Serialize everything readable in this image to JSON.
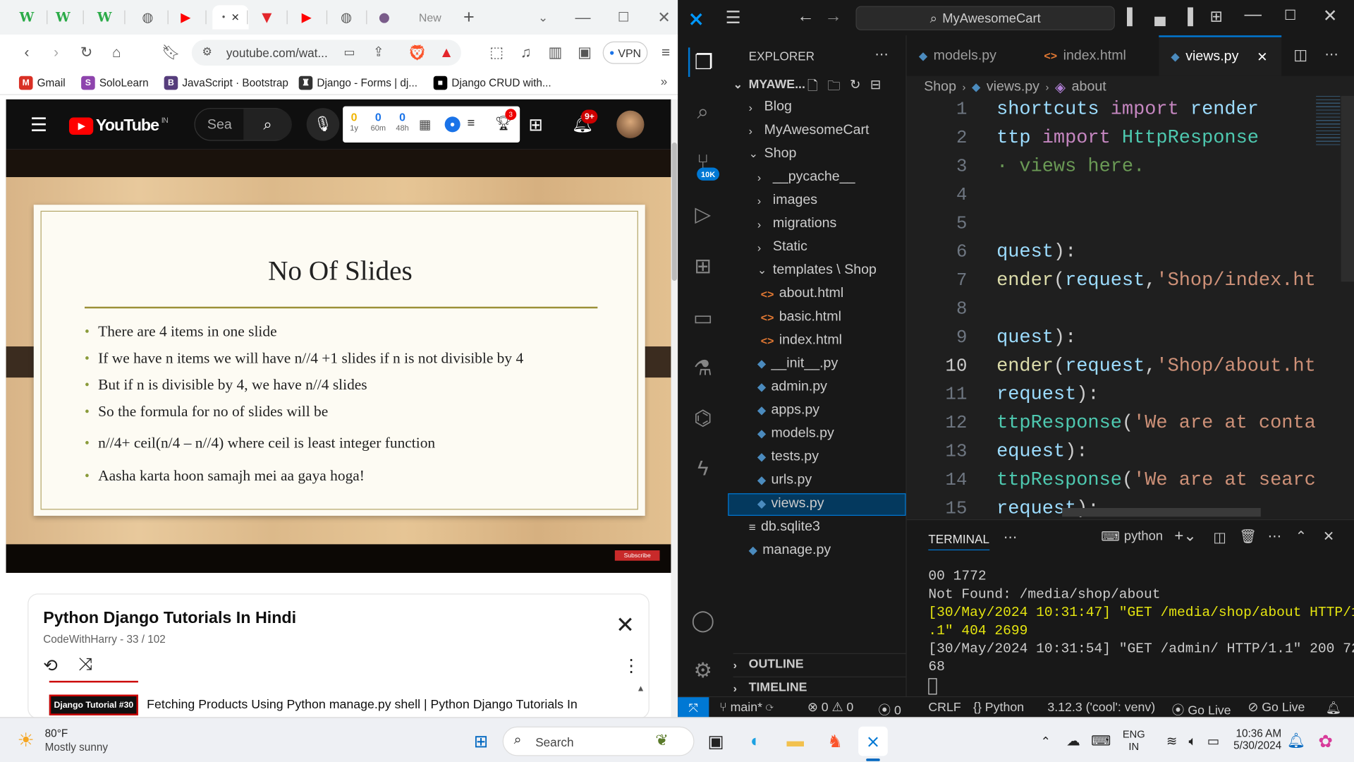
{
  "browser": {
    "tabs": [
      {
        "glyph": "W",
        "color": "#2bab48"
      },
      {
        "glyph": "W",
        "color": "#2bab48"
      },
      {
        "glyph": "W",
        "color": "#2bab48"
      },
      {
        "glyph": "◍",
        "color": "#555"
      },
      {
        "glyph": "▶",
        "color": "#ff0000"
      },
      {
        "glyph": "·",
        "color": "#555"
      },
      {
        "glyph": "▼",
        "color": "#e3262b"
      },
      {
        "glyph": "▶",
        "color": "#ff0000"
      },
      {
        "glyph": "◍",
        "color": "#555"
      },
      {
        "glyph": "●",
        "color": "#7a5c8a"
      }
    ],
    "new_tab_label": "New",
    "url": "youtube.com/wat...",
    "vpn_label": "VPN",
    "bookmarks": [
      {
        "label": "Gmail",
        "icon": "M",
        "color": "#d93025"
      },
      {
        "label": "SoloLearn",
        "icon": "S",
        "color": "#8e44ad"
      },
      {
        "label": "JavaScript · Bootstrap",
        "icon": "B",
        "color": "#563d7c"
      },
      {
        "label": "Django - Forms | dj...",
        "icon": "♜",
        "color": "#333"
      },
      {
        "label": "Django CRUD with...",
        "icon": "■",
        "color": "#000"
      }
    ]
  },
  "youtube": {
    "logo_text": "YouTube",
    "country_code": "IN",
    "search_placeholder": "Sea",
    "stats": [
      {
        "value": "0",
        "label": "1y"
      },
      {
        "value": "0",
        "label": "60m"
      },
      {
        "value": "0",
        "label": "48h"
      }
    ],
    "notification_count": "9+",
    "notif_badge_small": "3",
    "slide": {
      "title": "No Of Slides",
      "bullets": [
        "There are 4 items in one slide",
        "If we have n items we will have n//4 +1 slides if n is not divisible by 4",
        "But if n is divisible by 4, we have n//4 slides",
        "So the formula for no of slides will be",
        "n//4+ ceil(n/4 – n//4) where ceil is least integer function",
        "Aasha karta hoon samajh mei aa gaya hoga!"
      ]
    },
    "subscribe_badge": "Subscribe",
    "playlist": {
      "title": "Python Django Tutorials In Hindi",
      "channel": "CodeWithHarry",
      "position": " - 33 / 102",
      "item_thumb": "Django Tutorial #30",
      "item_title": "Fetching Products Using Python manage.py shell | Python Django Tutorials In"
    }
  },
  "vscode": {
    "command_center": "MyAwesomeCart",
    "source_control_badge": "10K",
    "explorer": {
      "header": "EXPLORER",
      "root": "MYAWE...",
      "items": [
        {
          "label": "Blog",
          "type": "folder",
          "depth": 1,
          "open": false
        },
        {
          "label": "MyAwesomeCart",
          "type": "folder",
          "depth": 1,
          "open": false
        },
        {
          "label": "Shop",
          "type": "folder",
          "depth": 1,
          "open": true
        },
        {
          "label": "__pycache__",
          "type": "folder",
          "depth": 2,
          "open": false
        },
        {
          "label": "images",
          "type": "folder",
          "depth": 2,
          "open": false
        },
        {
          "label": "migrations",
          "type": "folder",
          "depth": 2,
          "open": false
        },
        {
          "label": "Static",
          "type": "folder",
          "depth": 2,
          "open": false
        },
        {
          "label": "templates \\ Shop",
          "type": "folder",
          "depth": 2,
          "open": true
        },
        {
          "label": "about.html",
          "type": "html",
          "depth": 3
        },
        {
          "label": "basic.html",
          "type": "html",
          "depth": 3
        },
        {
          "label": "index.html",
          "type": "html",
          "depth": 3
        },
        {
          "label": "__init__.py",
          "type": "py",
          "depth": 2
        },
        {
          "label": "admin.py",
          "type": "py",
          "depth": 2
        },
        {
          "label": "apps.py",
          "type": "py",
          "depth": 2
        },
        {
          "label": "models.py",
          "type": "py",
          "depth": 2
        },
        {
          "label": "tests.py",
          "type": "py",
          "depth": 2
        },
        {
          "label": "urls.py",
          "type": "py",
          "depth": 2
        },
        {
          "label": "views.py",
          "type": "py",
          "depth": 2,
          "selected": true
        },
        {
          "label": "db.sqlite3",
          "type": "db",
          "depth": 1
        },
        {
          "label": "manage.py",
          "type": "py",
          "depth": 1
        }
      ],
      "outline": "OUTLINE",
      "timeline": "TIMELINE"
    },
    "tabs": [
      {
        "label": "models.py",
        "icon": "py"
      },
      {
        "label": "index.html",
        "icon": "html"
      },
      {
        "label": "views.py",
        "icon": "py",
        "active": true
      }
    ],
    "breadcrumb": [
      "Shop",
      "views.py",
      "about"
    ],
    "current_line": "10",
    "code_lines": [
      {
        "n": "1",
        "html": "<span class='var'>shortcuts</span> <span class='kw'>import</span> <span class='var'>render</span>"
      },
      {
        "n": "2",
        "html": "<span class='var'>ttp</span> <span class='kw'>import</span> <span class='cls'>HttpResponse</span>"
      },
      {
        "n": "3",
        "html": "<span class='cm'>· views here.</span>"
      },
      {
        "n": "4",
        "html": ""
      },
      {
        "n": "5",
        "html": ""
      },
      {
        "n": "6",
        "html": "<span class='var'>quest</span>):"
      },
      {
        "n": "7",
        "html": "<span class='fn'>ender</span>(<span class='var'>request</span>,<span class='str'>'Shop/index.ht</span>"
      },
      {
        "n": "8",
        "html": ""
      },
      {
        "n": "9",
        "html": "<span class='var'>quest</span>):"
      },
      {
        "n": "10",
        "html": "<span class='fn'>ender</span>(<span class='var'>request</span>,<span class='str'>'Shop/about.ht</span>"
      },
      {
        "n": "11",
        "html": "<span class='var'>request</span>):"
      },
      {
        "n": "12",
        "html": "<span class='cls'>ttpResponse</span>(<span class='str'>'We are at conta</span>"
      },
      {
        "n": "13",
        "html": "<span class='var'>equest</span>):"
      },
      {
        "n": "14",
        "html": "<span class='cls'>ttpResponse</span>(<span class='str'>'We are at searc</span>"
      },
      {
        "n": "15",
        "html": "<span class='var'>request</span>):"
      }
    ],
    "terminal": {
      "tab": "TERMINAL",
      "shell": "python",
      "lines": [
        {
          "text": "00 1772",
          "color": "#cccccc"
        },
        {
          "text": "Not Found: /media/shop/about",
          "color": "#cccccc"
        },
        {
          "text": "[30/May/2024 10:31:47] \"GET /media/shop/about HTTP/1",
          "color": "#e5e510"
        },
        {
          "text": ".1\" 404 2699",
          "color": "#e5e510"
        },
        {
          "text": "[30/May/2024 10:31:54] \"GET /admin/ HTTP/1.1\" 200 72",
          "color": "#cccccc"
        },
        {
          "text": "68",
          "color": "#cccccc"
        }
      ]
    },
    "status": {
      "branch": "main*",
      "errors": "0",
      "warnings": "0",
      "ports": "0",
      "eol": "CRLF",
      "language": "Python",
      "interpreter": "3.12.3 ('cool': venv)",
      "golive1": "Go Live",
      "golive2": "Go Live"
    }
  },
  "taskbar": {
    "weather_temp": "80°F",
    "weather_desc": "Mostly sunny",
    "search_label": "Search",
    "lang_top": "ENG",
    "lang_bottom": "IN",
    "time": "10:36 AM",
    "date": "5/30/2024"
  }
}
